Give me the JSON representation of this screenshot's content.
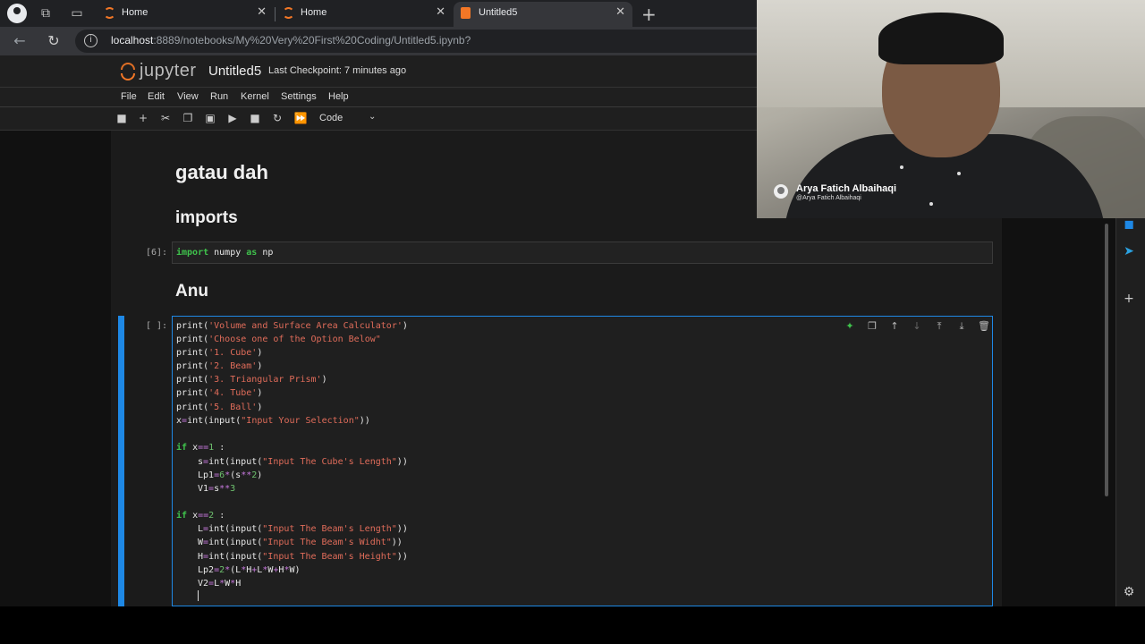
{
  "browser": {
    "tabs": [
      {
        "label": "Home",
        "active": false
      },
      {
        "label": "Home",
        "active": false
      },
      {
        "label": "Untitled5",
        "active": true
      }
    ],
    "url_host": "localhost",
    "url_rest": ":8889/notebooks/My%20Very%20First%20Coding/Untitled5.ipynb?"
  },
  "jupyter": {
    "logo_text": "jupyter",
    "notebook_name": "Untitled5",
    "checkpoint": "Last Checkpoint: 7 minutes ago",
    "menu": [
      "File",
      "Edit",
      "View",
      "Run",
      "Kernel",
      "Settings",
      "Help"
    ],
    "cell_type": "Code"
  },
  "notebook": {
    "heading_main": "gatau dah",
    "heading_imports": "imports",
    "imports_prompt": "[6]:",
    "heading_anu": "Anu",
    "active_prompt": "[ ]:"
  },
  "webcam": {
    "name": "Arya Fatich Albaihaqi",
    "handle": "@Arya Fatich Albaihaqi"
  },
  "colors": {
    "accent_blue": "#1e88e5",
    "jupyter_orange": "#f37726"
  }
}
